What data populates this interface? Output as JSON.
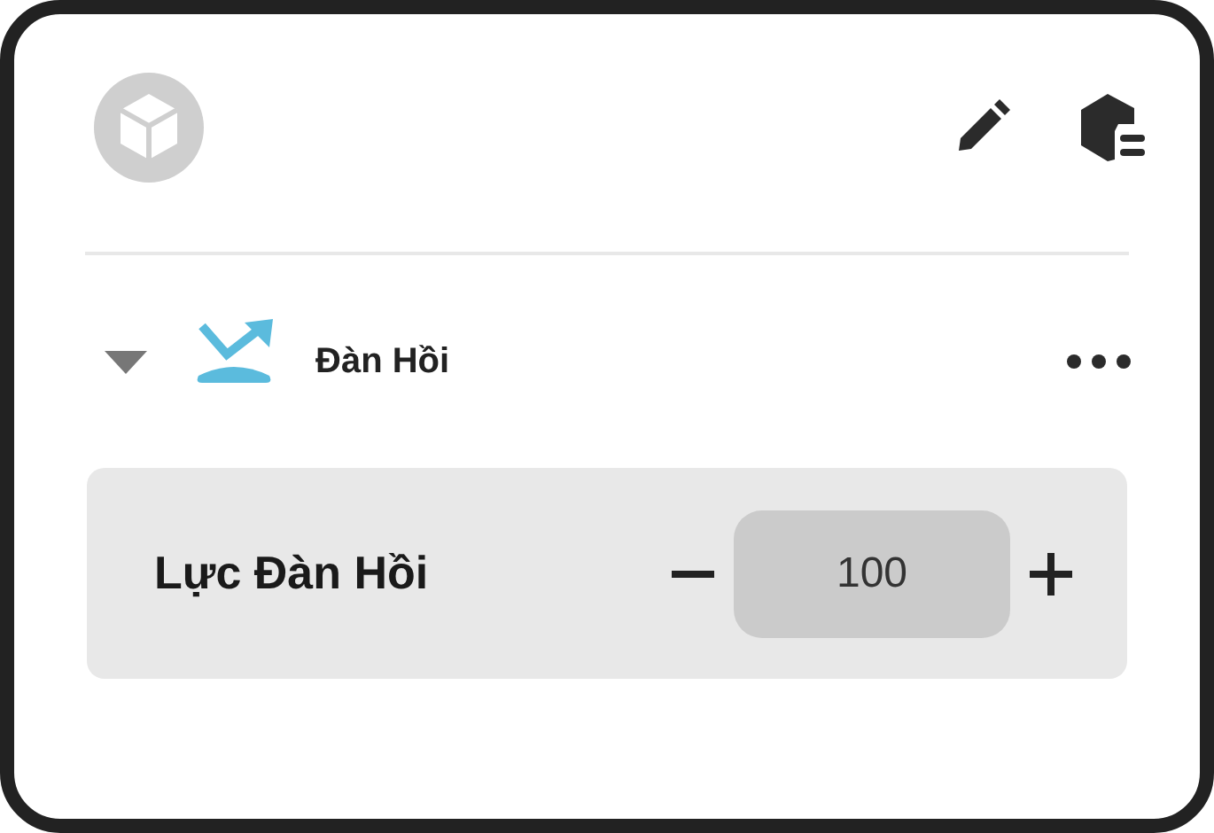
{
  "section": {
    "title": "Đàn Hồi",
    "expanded": true
  },
  "property": {
    "label": "Lực Đàn Hồi",
    "value": "100"
  }
}
